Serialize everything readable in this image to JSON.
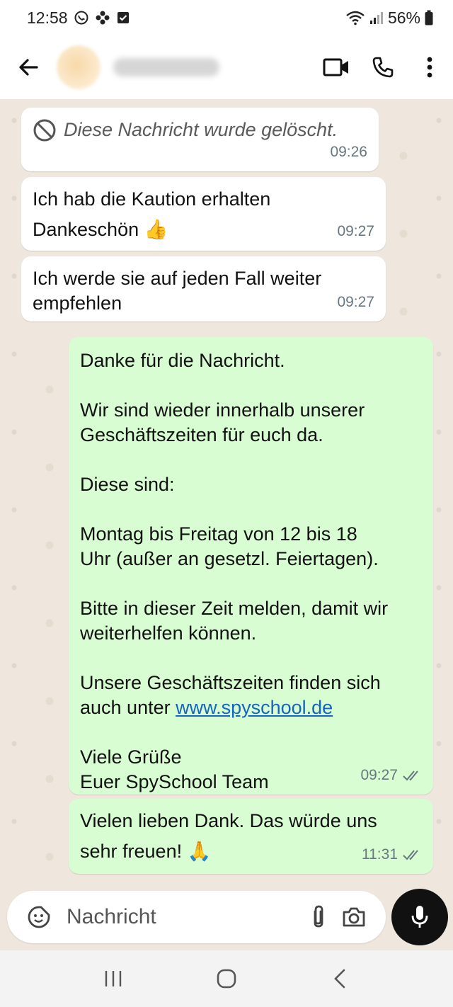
{
  "status_bar": {
    "time": "12:58",
    "battery": "56%"
  },
  "header": {
    "contact_name": "",
    "icons": [
      "back-arrow-icon",
      "video-call-icon",
      "phone-icon",
      "more-options-icon"
    ]
  },
  "messages": [
    {
      "direction": "in",
      "deleted": true,
      "text": "Diese Nachricht wurde gelöscht.",
      "time": "09:26"
    },
    {
      "direction": "in",
      "lines": [
        "Ich hab die Kaution erhalten",
        "Dankeschön 👍"
      ],
      "time": "09:27"
    },
    {
      "direction": "in",
      "lines": [
        "Ich werde sie auf jeden Fall weiter",
        "empfehlen"
      ],
      "time": "09:27"
    },
    {
      "direction": "out",
      "p1": "Danke für die Nachricht.",
      "p2a": "Wir sind wieder innerhalb unserer",
      "p2b": "Geschäftszeiten für euch da.",
      "p3": "Diese sind:",
      "p4a": "Montag bis Freitag von 12 bis 18",
      "p4b": "Uhr (außer an gesetzl. Feiertagen).",
      "p5a": "Bitte in dieser Zeit melden, damit wir",
      "p5b": "weiterhelfen können.",
      "p6a": "Unsere Geschäftszeiten finden sich",
      "p6b_prefix": "auch unter ",
      "p6b_link": "www.spyschool.de",
      "p7a": "Viele Grüße",
      "p7b": "Euer SpySchool Team",
      "time": "09:27",
      "status": "read"
    },
    {
      "direction": "out",
      "lines": [
        "Vielen lieben Dank. Das würde uns",
        "sehr freuen! 🙏"
      ],
      "time": "11:31",
      "status": "read"
    }
  ],
  "composer": {
    "placeholder": "Nachricht"
  },
  "colors": {
    "chat_background": "#efe7de",
    "incoming_bubble": "#ffffff",
    "outgoing_bubble": "#d9fdd3",
    "read_ticks": "#667781",
    "link": "#1565c0"
  }
}
